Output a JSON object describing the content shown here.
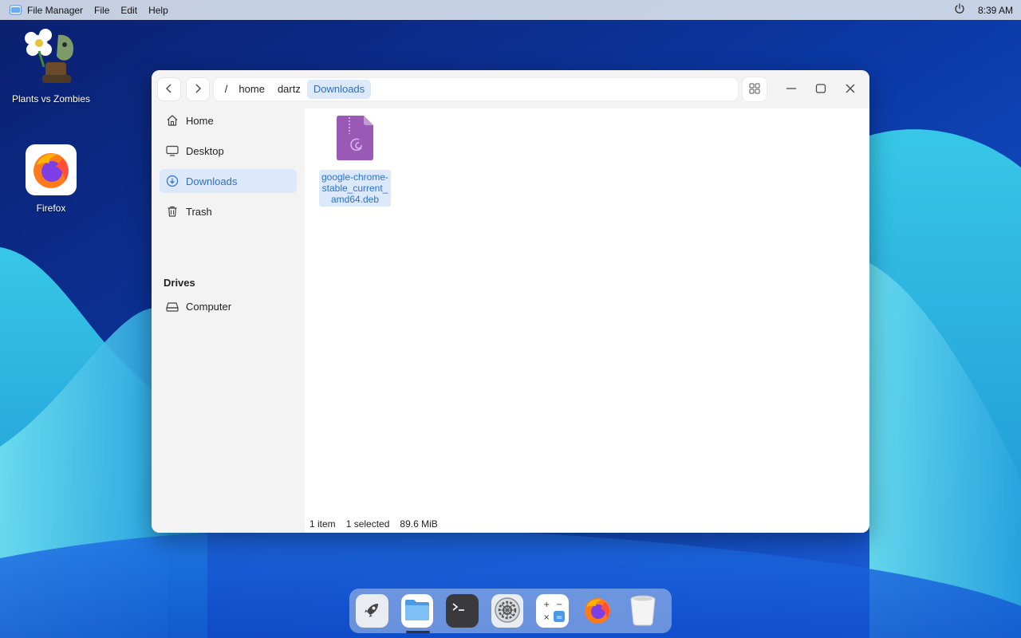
{
  "topbar": {
    "app_name": "File Manager",
    "menus": [
      "File",
      "Edit",
      "Help"
    ],
    "clock": "8:39 AM"
  },
  "desktop": {
    "icons": [
      {
        "label": "Plants vs Zombies",
        "icon": "plants-vs-zombies-icon"
      },
      {
        "label": "Firefox",
        "icon": "firefox-icon"
      }
    ]
  },
  "window": {
    "breadcrumb": {
      "root": "/",
      "parts": [
        "home",
        "dartz",
        "Downloads"
      ],
      "active": "Downloads"
    },
    "sidebar": {
      "items": [
        {
          "label": "Home",
          "icon": "home-icon"
        },
        {
          "label": "Desktop",
          "icon": "desktop-icon"
        },
        {
          "label": "Downloads",
          "icon": "downloads-icon",
          "active": true
        },
        {
          "label": "Trash",
          "icon": "trash-icon"
        }
      ],
      "drives_heading": "Drives",
      "drives": [
        {
          "label": "Computer",
          "icon": "drive-icon"
        }
      ]
    },
    "files": [
      {
        "name": "google-chrome-stable_current_amd64.deb",
        "icon": "deb-archive-icon",
        "selected": true
      }
    ],
    "status": {
      "count": "1 item",
      "selected": "1 selected",
      "size": "89.6 MiB"
    }
  },
  "dock": {
    "apps": [
      "launcher-icon",
      "file-manager-icon",
      "terminal-icon",
      "settings-icon",
      "calculator-icon",
      "firefox-icon",
      "trash-bin-icon"
    ],
    "running": "file-manager-icon"
  },
  "colors": {
    "accent": "#2d6fd1",
    "selection": "#dce9fb",
    "file_icon": "#9b59b6"
  }
}
